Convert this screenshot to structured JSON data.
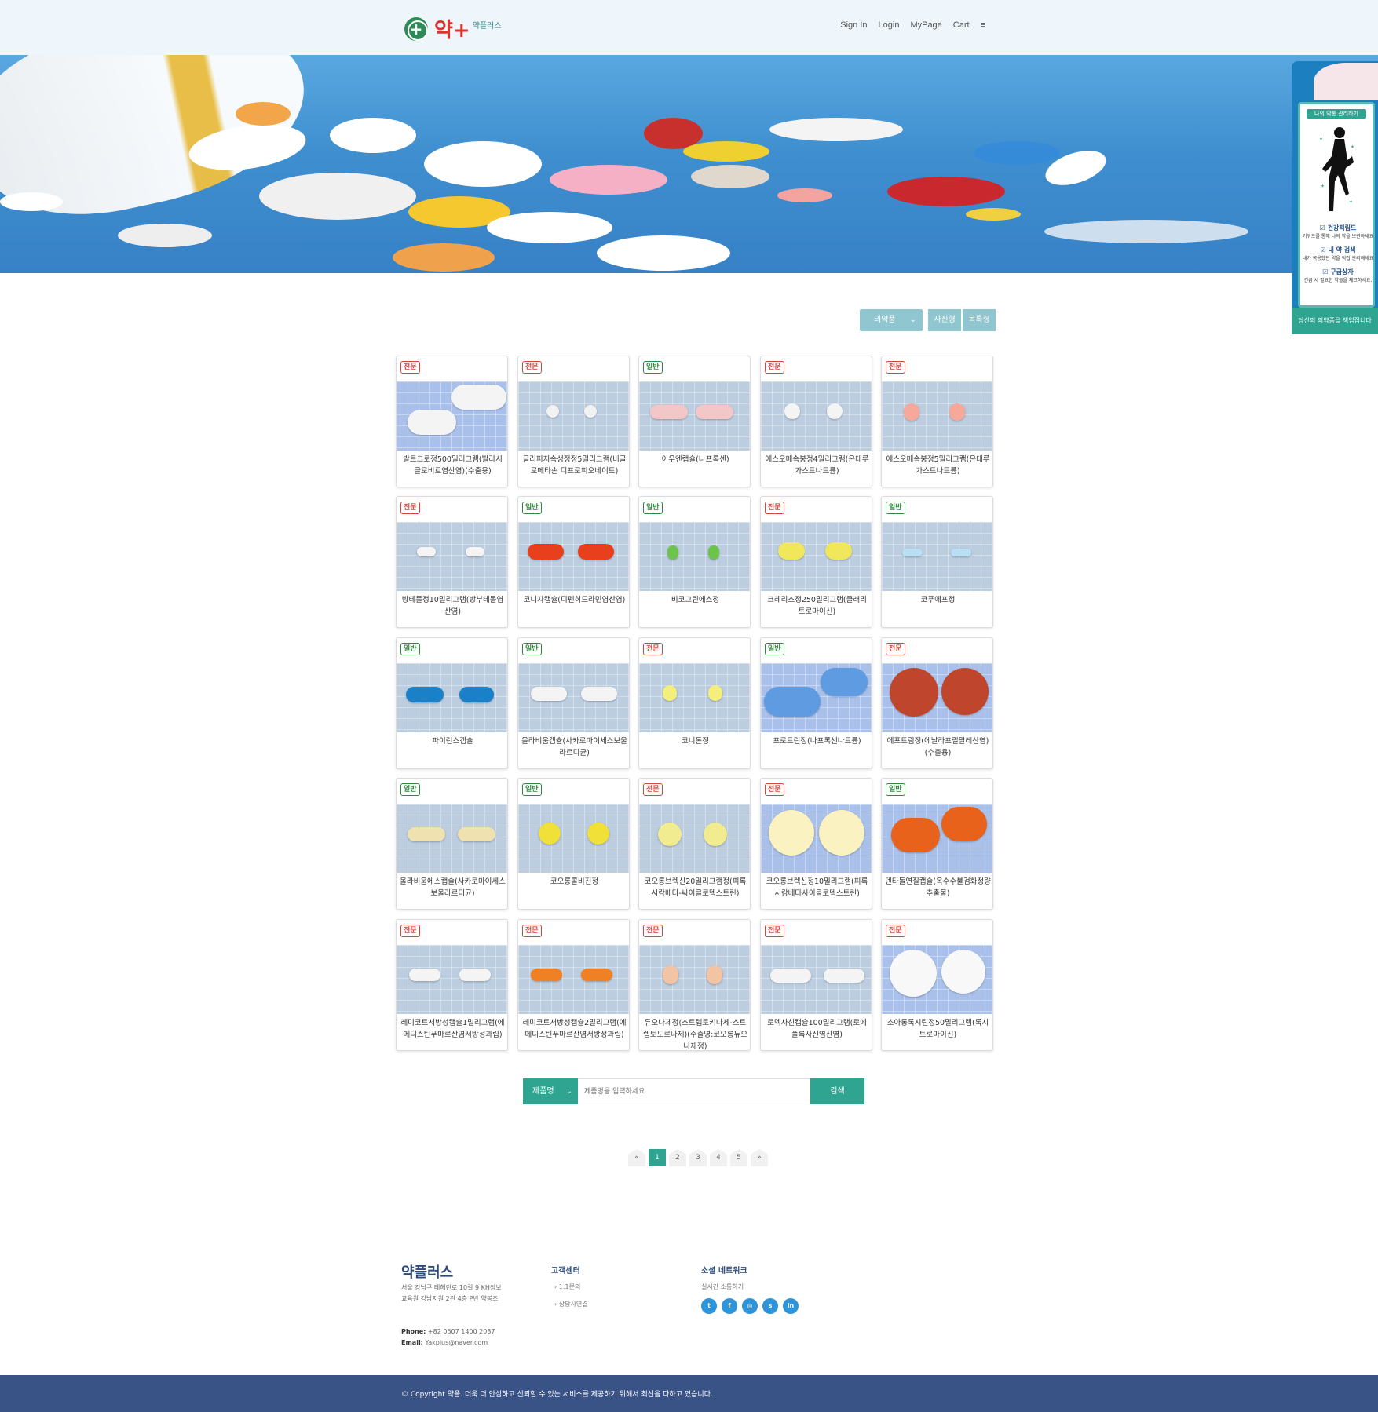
{
  "header": {
    "logo_mark": "+",
    "logo_main": "약+",
    "logo_sub": "약플러스",
    "nav": [
      "Sign In",
      "Login",
      "MyPage",
      "Cart",
      "≡"
    ]
  },
  "side_widget": {
    "badge": "나의 약통 관리하기",
    "features": [
      {
        "title": "☑ 건강적립드",
        "desc": "키워드를 통해 나의 약을 보관하세요"
      },
      {
        "title": "☑ 내 약 검색",
        "desc": "내가 복용했던 약을 직접 관리해세요"
      },
      {
        "title": "☑ 구급상자",
        "desc": "긴급 시 필요한 약들을 체크하세요."
      }
    ],
    "cta": "당신의 의약품을 책임집니다"
  },
  "filter": {
    "category": "의약품",
    "view_photo": "사진형",
    "view_list": "목록형"
  },
  "products": [
    {
      "badge": "전문",
      "type": "pro",
      "name": "발트크로정500밀리그램(발라시클로비르염산염)(수출용)"
    },
    {
      "badge": "전문",
      "type": "pro",
      "name": "글리피지속성정정5밀리그램(비글로메타손 디프로피오네이트)"
    },
    {
      "badge": "일반",
      "type": "gen",
      "name": "이우엔캡슐(나프록센)"
    },
    {
      "badge": "전문",
      "type": "pro",
      "name": "에스오메속붕정4밀리그램(온테루가스트나트륨)"
    },
    {
      "badge": "전문",
      "type": "pro",
      "name": "에스오메속붕정5밀리그램(온테루가스트나트륨)"
    },
    {
      "badge": "전문",
      "type": "pro",
      "name": "방테몰정10밀리그램(방부테몰염산염)"
    },
    {
      "badge": "일반",
      "type": "gen",
      "name": "코니자캡슐(디펜히드라민염산염)"
    },
    {
      "badge": "일반",
      "type": "gen",
      "name": "비코그린에스정"
    },
    {
      "badge": "전문",
      "type": "pro",
      "name": "크레리스정250밀리그램(클래리트로마이신)"
    },
    {
      "badge": "일반",
      "type": "gen",
      "name": "코푸에프정"
    },
    {
      "badge": "일반",
      "type": "gen",
      "name": "파이런스캡슐"
    },
    {
      "badge": "일반",
      "type": "gen",
      "name": "올라비움캡슐(사카로마이세스보울라르디균)"
    },
    {
      "badge": "전문",
      "type": "pro",
      "name": "코니돈정"
    },
    {
      "badge": "일반",
      "type": "gen",
      "name": "프로트린정(나프록센나트륨)"
    },
    {
      "badge": "전문",
      "type": "pro",
      "name": "에포트림정(에날라프릴말레산염)(수출용)"
    },
    {
      "badge": "일반",
      "type": "gen",
      "name": "올라비움에스캡슐(사카로마이세스보울라르디균)"
    },
    {
      "badge": "일반",
      "type": "gen",
      "name": "코오롱콜비진정"
    },
    {
      "badge": "전문",
      "type": "pro",
      "name": "코오롱브렉신20밀리그램정(피록시캄베타-싸이클로덱스트린)"
    },
    {
      "badge": "전문",
      "type": "pro",
      "name": "코오롱브렉신정10밀리그램(피록시캄베타사이클로덱스트린)"
    },
    {
      "badge": "일반",
      "type": "gen",
      "name": "덴타돌연질캡슐(옥수수불검화정량추출물)"
    },
    {
      "badge": "전문",
      "type": "pro",
      "name": "레미코트서방성캡슐1밀리그램(에메디스틴푸마르산염서방성과립)"
    },
    {
      "badge": "전문",
      "type": "pro",
      "name": "레미코트서방성캡슐2밀리그램(에메디스틴푸마르산염서방성과립)"
    },
    {
      "badge": "전문",
      "type": "pro",
      "name": "듀오나제정(스트렙토키나제-스트렙토도르나제)(수출명:코오롱듀오나제정)"
    },
    {
      "badge": "전문",
      "type": "pro",
      "name": "로멕사신캡슐100밀리그램(로메플록사신염산염)"
    },
    {
      "badge": "전문",
      "type": "pro",
      "name": "소아롱록시틴정50밀리그램(록시트로마이신)"
    }
  ],
  "search": {
    "select": "제품명",
    "placeholder": "제품명을 입력하세요",
    "button": "검색"
  },
  "pagination": [
    "«",
    "1",
    "2",
    "3",
    "4",
    "5",
    "»"
  ],
  "footer": {
    "brand": "약플러스",
    "address": "서울 강남구 테헤란로 10길 9 KH정보교육원 강남지원 2관 4층 P반 약봉조",
    "phone_label": "Phone:",
    "phone": "+82 0507 1400 2037",
    "email_label": "Email:",
    "email": "Yakplus@naver.com",
    "support_title": "고객센터",
    "support_links": [
      "1:1문의",
      "상담사연결"
    ],
    "social_title": "소셜 네트워크",
    "social_sub": "실시간 소통하기",
    "socials": [
      "t",
      "f",
      "◎",
      "s",
      "in"
    ],
    "copyright": "© Copyright 약플. 더욱 더 안심하고 신뢰할 수 있는 서비스를 제공하기 위해서 최선을 다하고 있습니다."
  },
  "colors": {
    "accent": "#2fa591",
    "brand_red": "#e0312b",
    "footer_bar": "#3a5387",
    "header_bg": "#eef6fb"
  }
}
